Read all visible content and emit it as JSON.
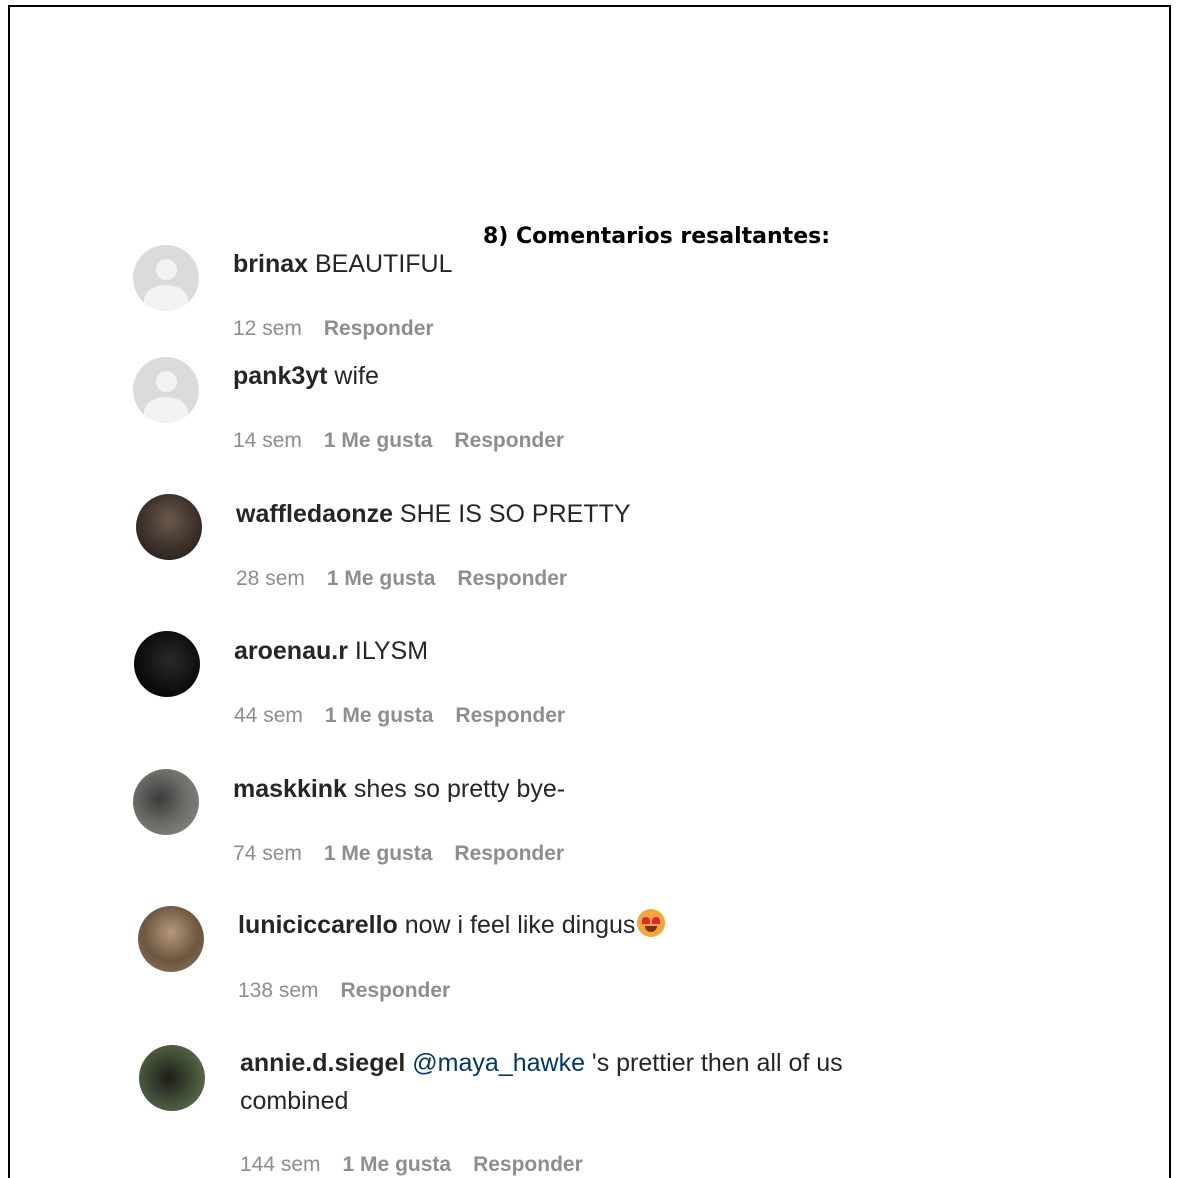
{
  "heading": "8) Comentarios resaltantes:",
  "comments": [
    {
      "username": "brinax",
      "text": " BEAUTIFUL",
      "time": "12 sem",
      "likes": "",
      "reply": "Responder",
      "avatar_icon": "default-avatar-icon"
    },
    {
      "username": "pank3yt",
      "text": " wife",
      "time": "14 sem",
      "likes": "1 Me gusta",
      "reply": "Responder",
      "avatar_icon": "default-avatar-icon"
    },
    {
      "username": "waffledaonze",
      "text": " SHE IS SO PRETTY",
      "time": "28 sem",
      "likes": "1 Me gusta",
      "reply": "Responder",
      "avatar_icon": "profile-photo"
    },
    {
      "username": "aroenau.r",
      "text": " ILYSM",
      "time": "44 sem",
      "likes": "1 Me gusta",
      "reply": "Responder",
      "avatar_icon": "profile-photo"
    },
    {
      "username": "maskkink",
      "text": " shes so pretty bye-",
      "time": "74 sem",
      "likes": "1 Me gusta",
      "reply": "Responder",
      "avatar_icon": "profile-photo"
    },
    {
      "username": "luniciccarello",
      "text": " now i feel like dingus",
      "time": "138 sem",
      "likes": "",
      "reply": "Responder",
      "avatar_icon": "profile-photo",
      "emoji": "heart-eyes-emoji"
    },
    {
      "username": "annie.d.siegel",
      "mention": "@maya_hawke",
      "text": " 's prettier then all of us combined",
      "time": "144 sem",
      "likes": "1 Me gusta",
      "reply": "Responder",
      "avatar_icon": "profile-photo"
    }
  ]
}
